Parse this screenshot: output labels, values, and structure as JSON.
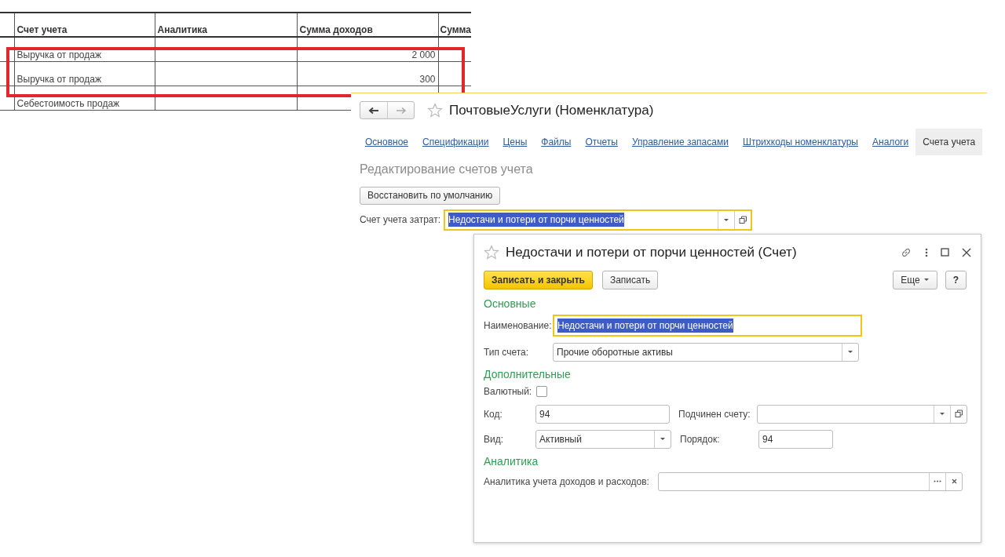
{
  "spreadsheet": {
    "columns": [
      {
        "label": "Счет учета"
      },
      {
        "label": "Аналитика"
      },
      {
        "label": "Сумма доходов"
      },
      {
        "label": "Сумма"
      }
    ],
    "rows": [
      {
        "account": "Выручка от продаж",
        "income": "2 000",
        "highlighted": true
      },
      {
        "account": "Выручка от продаж",
        "income": "300",
        "highlighted": true
      },
      {
        "account": "Себестоимость продаж",
        "highlighted": false
      }
    ]
  },
  "item_form": {
    "title": "ПочтовыеУслуги (Номенклатура)",
    "tabs": [
      {
        "label": "Основное",
        "selected": false
      },
      {
        "label": "Спецификации",
        "selected": false
      },
      {
        "label": "Цены",
        "selected": false
      },
      {
        "label": "Файлы",
        "selected": false
      },
      {
        "label": "Отчеты",
        "selected": false
      },
      {
        "label": "Управление запасами",
        "selected": false
      },
      {
        "label": "Штрихкоды номенклатуры",
        "selected": false
      },
      {
        "label": "Аналоги",
        "selected": false
      },
      {
        "label": "Счета учета",
        "selected": true
      }
    ],
    "heading": "Редактирование счетов учета",
    "reset_button": "Восстановить по умолчанию",
    "cost_account": {
      "label": "Счет учета затрат:",
      "value": "Недостачи и потери от порчи ценностей",
      "focused": true
    }
  },
  "account_dialog": {
    "title": "Недостачи и потери от порчи ценностей (Счет)",
    "buttons": [
      {
        "label": "Записать и закрыть",
        "primary": true
      },
      {
        "label": "Записать",
        "primary": false
      }
    ],
    "more_button": "Еще",
    "help_button": "?",
    "sections": [
      {
        "title": "Основные",
        "rows": [
          [
            {
              "kind": "text",
              "label": "Наименование:",
              "value": "Недостачи и потери от порчи ценностей",
              "focused": true
            }
          ],
          [
            {
              "kind": "select",
              "label": "Тип счета:",
              "value": "Прочие оборотные активы",
              "focused": false
            }
          ]
        ]
      },
      {
        "title": "Дополнительные",
        "rows": [
          [
            {
              "kind": "checkbox",
              "label": "Валютный:",
              "checked": false
            }
          ],
          [
            {
              "kind": "text",
              "label": "Код:",
              "value": "94",
              "focused": false
            },
            {
              "kind": "select-open",
              "label": "Подчинен счету:",
              "focused": false
            }
          ],
          [
            {
              "kind": "select",
              "label": "Вид:",
              "value": "Активный",
              "focused": false
            },
            {
              "kind": "text",
              "label": "Порядок:",
              "value": "94",
              "focused": false
            }
          ]
        ]
      },
      {
        "title": "Аналитика",
        "rows": [
          [
            {
              "kind": "pick-clear",
              "label": "Аналитика учета доходов и расходов:",
              "focused": false
            }
          ]
        ]
      }
    ]
  }
}
